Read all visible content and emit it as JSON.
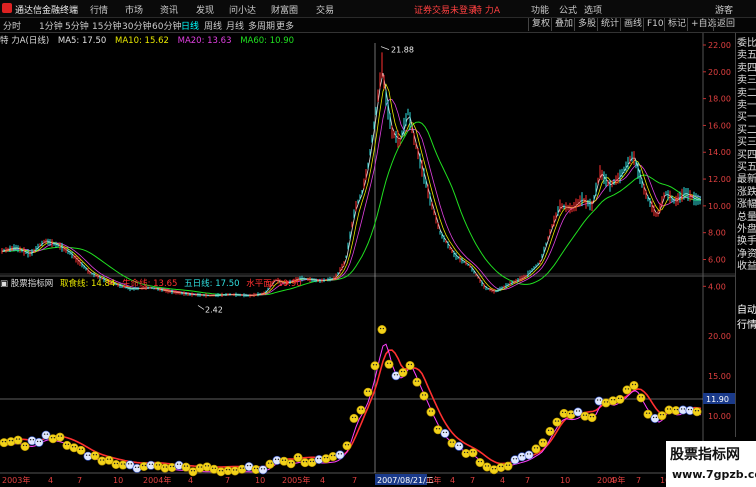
{
  "app": {
    "title": "通达信金融终端"
  },
  "menu": {
    "items": [
      "行情",
      "市场",
      "资讯",
      "发现",
      "问小达",
      "财富圈",
      "交易"
    ],
    "status": "证券交易未登录",
    "stock": "特 力A",
    "right_items": [
      "功能",
      "公式",
      "选项"
    ],
    "guest": "游客"
  },
  "periods": [
    "分时",
    "1分钟",
    "5分钟",
    "15分钟",
    "30分钟",
    "60分钟",
    "日线",
    "周线",
    "月线",
    "多周期",
    "更多"
  ],
  "active_period": "日线",
  "tools": [
    "复权",
    "叠加",
    "多股",
    "统计",
    "画线",
    "F10",
    "标记",
    "+自选",
    "返回"
  ],
  "main_chart": {
    "stock_label": "特 力A(日线)",
    "ma": [
      {
        "label": "MA5: 17.50",
        "color": "#e0e0e0"
      },
      {
        "label": "MA10: 15.62",
        "color": "#e8e800"
      },
      {
        "label": "MA20: 13.63",
        "color": "#e040e0"
      },
      {
        "label": "MA60: 10.90",
        "color": "#20e020"
      }
    ],
    "high_label": "21.88",
    "low_label": "2.42",
    "y_ticks": [
      "22.00",
      "20.00",
      "18.00",
      "16.00",
      "14.00",
      "12.00",
      "10.00",
      "8.00",
      "6.00",
      "4.00"
    ]
  },
  "indicator": {
    "name": "股票指标网",
    "lines": [
      {
        "label": "取食线: 14.84",
        "color": "#e8e800"
      },
      {
        "label": "生命线: 13.65",
        "color": "#ff3030"
      },
      {
        "label": "五日线: 17.50",
        "color": "#30e0e0"
      },
      {
        "label": "水平面: 10.90",
        "color": "#ff3030"
      }
    ],
    "y_ticks": [
      "20.00",
      "15.00",
      "10.00",
      "5.00"
    ],
    "crosshair_value": "11.90"
  },
  "xaxis": {
    "labels": [
      "2003年",
      "4",
      "7",
      "10",
      "2004年",
      "4",
      "7",
      "10",
      "2005年",
      "4",
      "7",
      "10",
      "2006年",
      "4",
      "7",
      "2007/08/21/二",
      "4",
      "7",
      "10",
      "2009年",
      "4",
      "7",
      "10",
      "2010年",
      "4",
      "7",
      "10"
    ]
  },
  "side_panel": {
    "items": [
      "委比",
      "卖五",
      "卖四",
      "卖三",
      "卖二",
      "卖一",
      "买一",
      "买二",
      "买三",
      "买四",
      "买五",
      "最新",
      "涨跌",
      "涨幅",
      "总量",
      "外盘",
      "换手",
      "净资",
      "收益",
      "自动",
      "行情"
    ]
  },
  "watermark": {
    "title": "股票指标网",
    "url": "www.7gpzb.com"
  }
}
